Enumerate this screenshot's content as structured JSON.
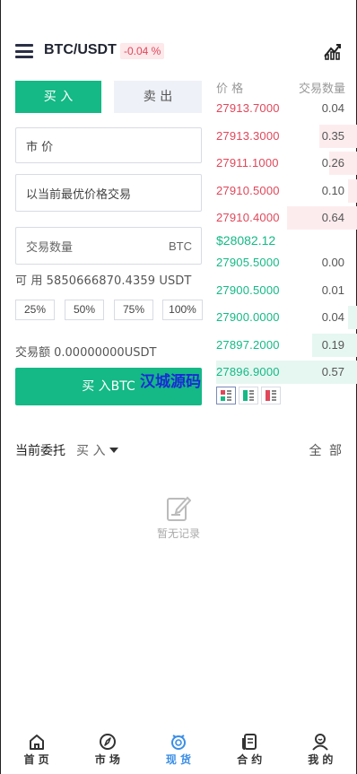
{
  "header": {
    "pair": "BTC/USDT",
    "change": "-0.04 %"
  },
  "trade": {
    "tab_buy": "买 入",
    "tab_sell": "卖 出",
    "order_type": "市 价",
    "price_field": "以当前最优价格交易",
    "amount_placeholder": "交易数量",
    "amount_unit": "BTC",
    "available": "可 用 5850666870.4359 USDT",
    "percents": [
      "25%",
      "50%",
      "75%",
      "100%"
    ],
    "turnover": "交易额 0.00000000USDT",
    "buy_button": "买 入BTC"
  },
  "orderbook": {
    "price_header": "价 格",
    "qty_header": "交易数量",
    "asks": [
      {
        "price": "27913.7000",
        "qty": "0.04",
        "depth": 0.0
      },
      {
        "price": "27913.3000",
        "qty": "0.35",
        "depth": 0.27
      },
      {
        "price": "27911.1000",
        "qty": "0.26",
        "depth": 0.2
      },
      {
        "price": "27910.5000",
        "qty": "0.10",
        "depth": 0.07
      },
      {
        "price": "27910.4000",
        "qty": "0.64",
        "depth": 0.5
      }
    ],
    "last_price": "$28082.12",
    "bids": [
      {
        "price": "27905.5000",
        "qty": "0.00",
        "depth": 0.0
      },
      {
        "price": "27900.5000",
        "qty": "0.01",
        "depth": 0.0
      },
      {
        "price": "27900.0000",
        "qty": "0.04",
        "depth": 0.07
      },
      {
        "price": "27897.2000",
        "qty": "0.19",
        "depth": 0.32
      },
      {
        "price": "27896.9000",
        "qty": "0.57",
        "depth": 1.0
      }
    ]
  },
  "watermark": "汉城源码",
  "orders": {
    "title": "当前委托",
    "filter": "买 入",
    "all": "全 部",
    "empty": "暂无记录"
  },
  "nav": [
    {
      "label": "首 页",
      "icon": "home-icon"
    },
    {
      "label": "市 场",
      "icon": "market-icon"
    },
    {
      "label": "现 货",
      "icon": "spot-icon"
    },
    {
      "label": "合 约",
      "icon": "contract-icon"
    },
    {
      "label": "我 的",
      "icon": "profile-icon"
    }
  ],
  "colors": {
    "accent": "#14b985",
    "ask": "#e0475a",
    "nav_active": "#3a8ee6"
  }
}
